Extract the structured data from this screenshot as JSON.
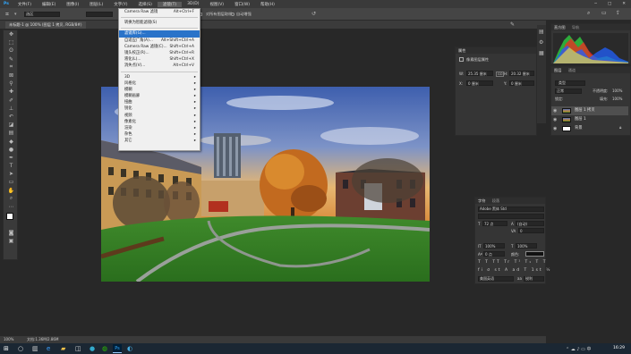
{
  "menu": {
    "items": [
      "文件(F)",
      "编辑(E)",
      "图像(I)",
      "图层(L)",
      "文字(Y)",
      "选择(S)",
      "滤镜(T)",
      "3D(D)",
      "视图(V)",
      "窗口(W)",
      "帮助(H)"
    ],
    "active_index": 6
  },
  "options_bar": {
    "tool_label": "选区",
    "checkbox1": "消除锯齿",
    "checkbox2": "对所有图层取样",
    "checkbox3": "自动增强"
  },
  "document_tab": "未标题-1 @ 100% (图层 1 拷贝, RGB/8#)",
  "filter_menu": {
    "items": [
      {
        "label": "Camera Raw 滤镜",
        "shortcut": "Alt+Ctrl+F",
        "state": "normal"
      },
      {
        "sep": true
      },
      {
        "label": "转换为智能滤镜(S)",
        "shortcut": "",
        "state": "normal"
      },
      {
        "sep": true
      },
      {
        "label": "滤镜库(G)...",
        "shortcut": "",
        "state": "sel"
      },
      {
        "label": "自适应广角(A)...",
        "shortcut": "Alt+Shift+Ctrl+A",
        "state": "normal"
      },
      {
        "label": "Camera Raw 滤镜(C)...",
        "shortcut": "Shift+Ctrl+A",
        "state": "normal"
      },
      {
        "label": "镜头校正(R)...",
        "shortcut": "Shift+Ctrl+R",
        "state": "normal"
      },
      {
        "label": "液化(L)...",
        "shortcut": "Shift+Ctrl+X",
        "state": "normal"
      },
      {
        "label": "消失点(V)...",
        "shortcut": "Alt+Ctrl+V",
        "state": "normal"
      },
      {
        "sep": true
      },
      {
        "label": "3D",
        "shortcut": "",
        "state": "sub"
      },
      {
        "label": "风格化",
        "shortcut": "",
        "state": "sub"
      },
      {
        "label": "模糊",
        "shortcut": "",
        "state": "sub"
      },
      {
        "label": "模糊画廊",
        "shortcut": "",
        "state": "sub"
      },
      {
        "label": "扭曲",
        "shortcut": "",
        "state": "sub"
      },
      {
        "label": "锐化",
        "shortcut": "",
        "state": "sub"
      },
      {
        "label": "视频",
        "shortcut": "",
        "state": "sub"
      },
      {
        "label": "像素化",
        "shortcut": "",
        "state": "sub"
      },
      {
        "label": "渲染",
        "shortcut": "",
        "state": "sub"
      },
      {
        "label": "杂色",
        "shortcut": "",
        "state": "sub"
      },
      {
        "label": "其它",
        "shortcut": "",
        "state": "sub"
      }
    ]
  },
  "properties_panel": {
    "title": "属性",
    "subtitle": "像素图层属性",
    "w_label": "W:",
    "w_value": "25.35 厘米",
    "link_label": "GO",
    "h_label": "H:",
    "h_value": "20.32 厘米",
    "x_label": "X:",
    "x_value": "0 厘米",
    "y_label": "Y:",
    "y_value": "0 厘米"
  },
  "histogram_panel": {
    "tab1": "直方图",
    "tab2": "导航"
  },
  "layers_panel": {
    "tab1": "图层",
    "tab2": "通道",
    "kind": "类型",
    "blend": "正常",
    "opacity_label": "不透明度:",
    "opacity": "100%",
    "lock_label": "锁定:",
    "fill_label": "填充:",
    "fill": "100%",
    "layers": [
      {
        "name": "图层 1 拷贝",
        "selected": true,
        "type": "photo"
      },
      {
        "name": "图层 1",
        "selected": false,
        "type": "photo"
      },
      {
        "name": "背景",
        "selected": false,
        "type": "white"
      }
    ]
  },
  "character_panel": {
    "tab1": "字符",
    "tab2": "段落",
    "font": "Adobe 黑体 Std",
    "size": "72 点",
    "leading": "(自动)",
    "tracking": "0",
    "scale_v": "100%",
    "scale_h": "100%",
    "baseline": "0 点",
    "color_label": "颜色:",
    "language": "美国英语",
    "aa": "锐利"
  },
  "status": {
    "zoom": "100%",
    "doc_info": "文档:1.36M/2.86M"
  },
  "taskbar": {
    "time": "16:29"
  },
  "colors": {
    "accent": "#2a73c9"
  }
}
